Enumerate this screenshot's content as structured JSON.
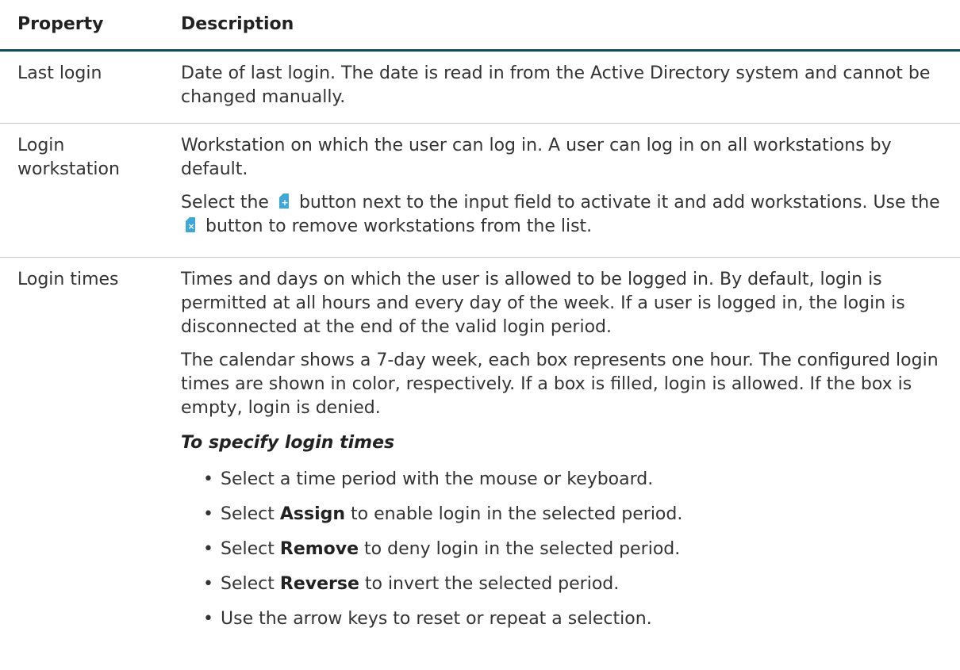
{
  "header": {
    "property_label": "Property",
    "description_label": "Description"
  },
  "rows": [
    {
      "property": "Last login",
      "description": "Date of last login. The date is read in from the Active Directory system and cannot be changed manually."
    },
    {
      "property": "Login workstation",
      "description_1": "Workstation on which the user can log in. A user can log in on all workstations by default.",
      "description_2_part1": "Select the",
      "description_2_part2": "button next to the input field to activate it and add workstations. Use the",
      "description_2_part3": "button to remove workstations from the list.",
      "add_icon_glyph": "+",
      "remove_icon_glyph": "×"
    },
    {
      "property": "Login times",
      "description_1": "Times and days on which the user is allowed to be logged in. By default, login is permitted at all hours and every day of the week. If a user is logged in, the login is disconnected at the end of the valid login period.",
      "description_2": "The calendar shows a 7-day week, each box represents one hour. The configured login times are shown in color, respectively. If a box is filled, login is allowed. If the box is empty, login is denied.",
      "subheading": "To specify login times",
      "steps": [
        {
          "prefix": "Select a time period with the mouse or keyboard.",
          "bold": "",
          "suffix": ""
        },
        {
          "prefix": "Select ",
          "bold": "Assign",
          "suffix": " to enable login in the selected period."
        },
        {
          "prefix": "Select ",
          "bold": "Remove",
          "suffix": " to deny login in the selected period."
        },
        {
          "prefix": "Select ",
          "bold": "Reverse",
          "suffix": " to invert the selected period."
        },
        {
          "prefix": "Use the arrow keys to reset or repeat a selection.",
          "bold": "",
          "suffix": ""
        }
      ],
      "bullet": "•"
    }
  ],
  "colors": {
    "header_rule": "#0f4c5c",
    "icon_blue": "#3fa7d6",
    "row_divider": "#c8c8c8"
  },
  "icons": [
    "add-workstation-icon",
    "remove-workstation-icon"
  ]
}
